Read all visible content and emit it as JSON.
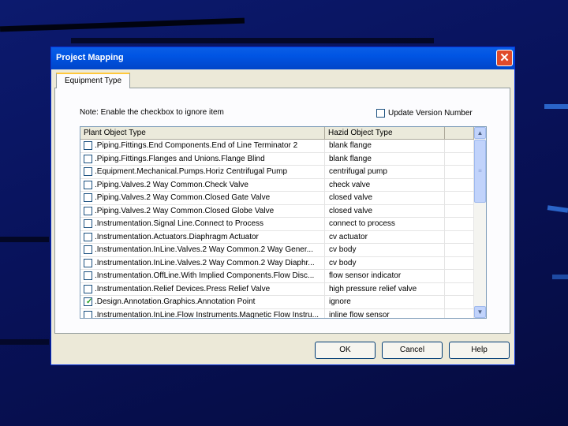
{
  "dialog": {
    "title": "Project Mapping",
    "close_glyph": "✕"
  },
  "tab": {
    "label": "Equipment Type"
  },
  "note": "Note: Enable the checkbox to ignore item",
  "update_version": {
    "label": "Update Version Number",
    "checked": false
  },
  "grid": {
    "headers": [
      "Plant Object Type",
      "Hazid Object Type"
    ],
    "rows": [
      {
        "plant": ".Piping.Fittings.End Components.End of Line Terminator 2",
        "hazid": "blank flange",
        "checked": false
      },
      {
        "plant": ".Piping.Fittings.Flanges and Unions.Flange Blind",
        "hazid": "blank flange",
        "checked": false
      },
      {
        "plant": ".Equipment.Mechanical.Pumps.Horiz Centrifugal Pump",
        "hazid": "centrifugal pump",
        "checked": false
      },
      {
        "plant": ".Piping.Valves.2 Way Common.Check Valve",
        "hazid": "check valve",
        "checked": false
      },
      {
        "plant": ".Piping.Valves.2 Way Common.Closed Gate Valve",
        "hazid": "closed valve",
        "checked": false
      },
      {
        "plant": ".Piping.Valves.2 Way Common.Closed Globe Valve",
        "hazid": "closed valve",
        "checked": false
      },
      {
        "plant": ".Instrumentation.Signal Line.Connect to Process",
        "hazid": "connect to process",
        "checked": false
      },
      {
        "plant": ".Instrumentation.Actuators.Diaphragm Actuator",
        "hazid": "cv actuator",
        "checked": false
      },
      {
        "plant": ".Instrumentation.InLine.Valves.2 Way Common.2 Way Gener...",
        "hazid": "cv body",
        "checked": false
      },
      {
        "plant": ".Instrumentation.InLine.Valves.2 Way Common.2 Way Diaphr...",
        "hazid": "cv body",
        "checked": false
      },
      {
        "plant": ".Instrumentation.OffLine.With Implied Components.Flow Disc...",
        "hazid": "flow sensor indicator",
        "checked": false
      },
      {
        "plant": ".Instrumentation.Relief Devices.Press Relief Valve",
        "hazid": "high pressure relief valve",
        "checked": false
      },
      {
        "plant": ".Design.Annotation.Graphics.Annotation Point",
        "hazid": "ignore",
        "checked": true
      },
      {
        "plant": ".Instrumentation.InLine.Flow Instruments.Magnetic Flow Instru...",
        "hazid": "inline flow sensor",
        "checked": false
      }
    ]
  },
  "scrollbar": {
    "up_glyph": "▲",
    "down_glyph": "▼",
    "thumb_grip": "≡"
  },
  "buttons": {
    "ok": "OK",
    "cancel": "Cancel",
    "help": "Help"
  },
  "colors": {
    "title_bar": "#0054e3",
    "close_button": "#e04a2a",
    "dialog_bg": "#ece9d8",
    "desktop_bg": "#0c1a6e"
  }
}
